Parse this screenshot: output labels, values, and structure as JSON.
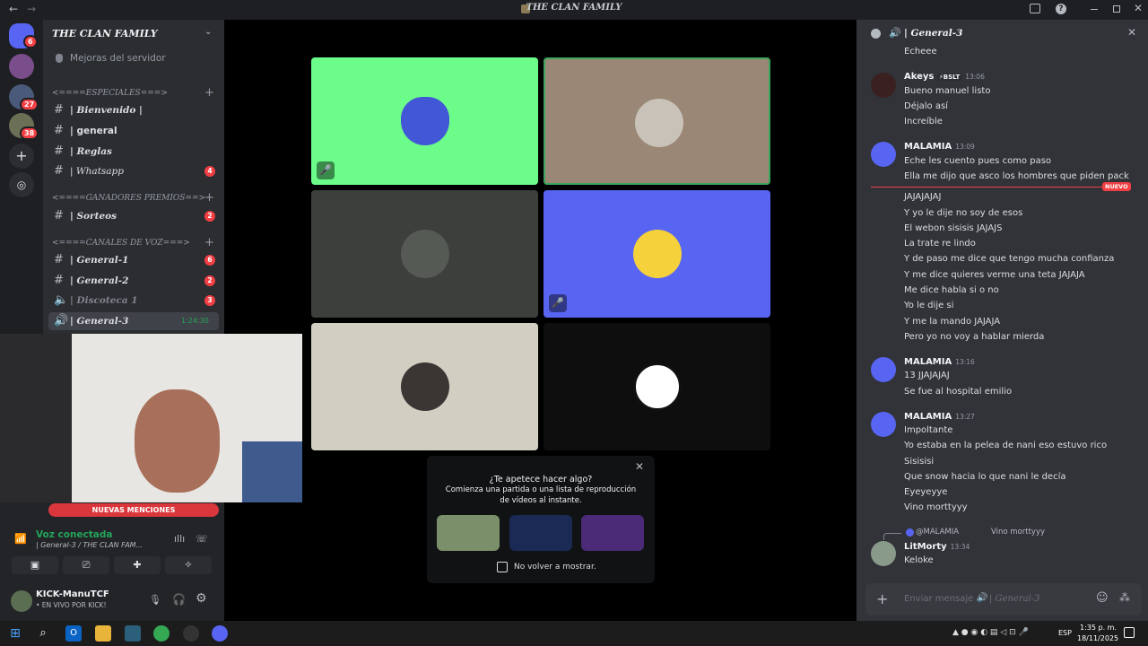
{
  "window": {
    "title": "THE CLAN FAMILY",
    "back": "←",
    "forward": "→"
  },
  "rail": {
    "badges": {
      "home": "6",
      "srv2": "27",
      "srv3": "38"
    }
  },
  "sidebar": {
    "server_name": "THE CLAN FAMILY",
    "boost": "Mejoras del servidor",
    "cat1": "<====ESPECIALES===>",
    "cat2": "<====GANADORES PREMIOS==>",
    "cat3": "<====CANALES DE VOZ===>",
    "channels": [
      {
        "label": "| Bienvenido |",
        "count": ""
      },
      {
        "label": "| general",
        "count": ""
      },
      {
        "label": "| Reglas",
        "count": ""
      },
      {
        "label": "| Whatsapp",
        "count": "4"
      },
      {
        "label": "| Sorteos",
        "count": "2"
      },
      {
        "label": "| General-1",
        "count": "6"
      },
      {
        "label": "| General-2",
        "count": "2"
      },
      {
        "label": "| Discoteca 1",
        "count": "3"
      },
      {
        "label": "| General-3",
        "count": "1:24:30"
      }
    ]
  },
  "voice": {
    "mention": "NUEVAS MENCIONES",
    "status": "Voz conectada",
    "channel": "| General-3 / THE CLAN FAM...",
    "user": "KICK-ManuTCF",
    "substatus": "• EN VIVO POR KICK!"
  },
  "activity": {
    "title": "¿Te apetece hacer algo?",
    "desc1": "Comienza una partida o una lista de reproducción",
    "desc2": "de vídeos al instante.",
    "checkbox": "No volver a mostrar.",
    "close": "✕"
  },
  "chat": {
    "header": "| General-3",
    "first": "Echeee",
    "akeys": {
      "author": "Akeys",
      "tag": "⚡BSLT",
      "time": "13:06",
      "lines": [
        "Bueno manuel listo",
        "Déjalo así",
        "Increíble"
      ]
    },
    "m1": {
      "author": "MALAMIA",
      "time": "13:09",
      "lines": [
        "Eche les cuento pues como paso",
        "Ella me dijo que asco los hombres que piden pack"
      ]
    },
    "new": "NUEVO",
    "cont": [
      "JAJAJAJAJ",
      "Y yo le dije no soy de esos",
      "El webon sisisis JAJAJS",
      "La trate re lindo",
      "Y de paso me dice que tengo mucha confianza",
      "Y me dice quieres verme una teta JAJAJA",
      "Me dice habla si o no",
      "Yo le dije si",
      "Y me la mando JAJAJA",
      "Pero yo no voy a hablar mierda"
    ],
    "m2": {
      "author": "MALAMIA",
      "time": "13:16",
      "lines": [
        "13 JJAJAJAJ",
        "Se fue al hospital emilio"
      ]
    },
    "m3": {
      "author": "MALAMIA",
      "time": "13:27",
      "lines": [
        "Impoltante",
        "Yo estaba en la pelea de nani eso estuvo rico",
        "Sisisisi",
        "Que snow hacia lo que nani le decía",
        "Eyeyeyye",
        "Vino morttyyy"
      ]
    },
    "reply": "@MALAMIA",
    "reply_text": "Vino morttyyy",
    "m4": {
      "author": "LitMorty",
      "time": "13:34",
      "lines": [
        "Keloke"
      ]
    },
    "input_placeholder": "Enviar mensaje a",
    "input_channel": "| General-3"
  },
  "taskbar": {
    "lang": "ESP",
    "time": "1:35 p. m.",
    "date": "18/11/2025"
  }
}
